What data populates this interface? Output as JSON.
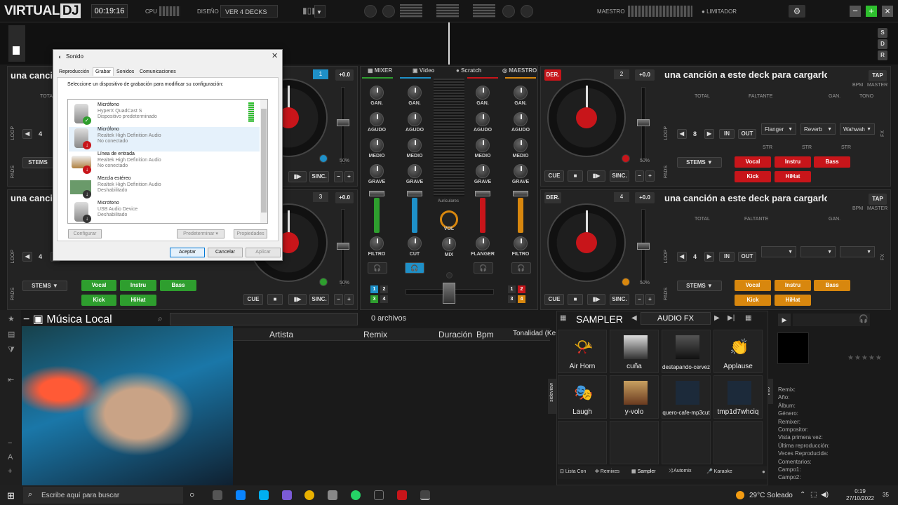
{
  "app": {
    "logo_main": "VIRTUAL",
    "logo_dj": "DJ",
    "time": "00:19:16",
    "cpu_label": "CPU",
    "design_label": "DISEÑO",
    "design_value": "VER 4 DECKS",
    "master_label": "MAESTRO",
    "limiter_label": "LIMITADOR"
  },
  "side_buttons": [
    "S",
    "D",
    "R"
  ],
  "decks": {
    "d1": {
      "title": "una canción a este deck para cargarlo",
      "title_visible": "una canci",
      "number": "1",
      "pitch": "+0.0",
      "total": "TOTAL"
    },
    "d2": {
      "title": "una canción a este deck para cargarlo",
      "number": "2",
      "pitch": "+0.0",
      "total": "TOTAL",
      "remaining": "FALTANTE",
      "gain": "GAN.",
      "tone": "TONO",
      "bpm": "BPM",
      "master": "MASTER",
      "tap": "TAP",
      "der": "DER."
    },
    "d3": {
      "title_visible": "una canci",
      "number": "3",
      "pitch": "+0.0"
    },
    "d4": {
      "title": "una canción a este deck para cargarlo",
      "number": "4",
      "pitch": "+0.0",
      "total": "TOTAL",
      "remaining": "FALTANTE",
      "gain": "GAN.",
      "bpm": "BPM",
      "master": "MASTER",
      "tap": "TAP",
      "der": "DER."
    }
  },
  "controls": {
    "loop": "LOOP",
    "pads": "PADS",
    "stems": "STEMS",
    "cue": "CUE",
    "sync": "SINC.",
    "in": "IN",
    "out": "OUT",
    "loop_d2": "8",
    "loop_d1": "4",
    "loop_d3": "4",
    "loop_d4": "4",
    "fx": "FX",
    "str": "STR",
    "fx_slots": [
      "Flanger",
      "Reverb",
      "Wahwah"
    ],
    "pad_labels": [
      "Vocal",
      "Instru",
      "Bass",
      "Kick",
      "HiHat"
    ],
    "percent": "50%"
  },
  "mixer_tabs": [
    "MIXER",
    "Video",
    "Scratch",
    "MAESTRO"
  ],
  "mixer": {
    "gain": "GAN.",
    "treble": "AGUDO",
    "mid": "MEDIO",
    "bass": "GRAVE",
    "filter": "FILTRO",
    "cut": "CUT",
    "flanger": "FLANGER",
    "headphones": "Auriculares",
    "vol": "VOL",
    "mix": "MIX",
    "decknums": [
      "1",
      "2",
      "3",
      "4"
    ]
  },
  "dialog": {
    "title": "Sonido",
    "tabs": [
      "Reproducción",
      "Grabar",
      "Sonidos",
      "Comunicaciones"
    ],
    "instruction": "Seleccione un dispositivo de grabación para modificar su configuración:",
    "devices": [
      {
        "name": "Micrófono",
        "desc": "HyperX QuadCast S",
        "status": "Dispositivo predeterminado"
      },
      {
        "name": "Micrófono",
        "desc": "Realtek High Definition Audio",
        "status": "No conectado"
      },
      {
        "name": "Línea de entrada",
        "desc": "Realtek High Definition Audio",
        "status": "No conectado"
      },
      {
        "name": "Mezcla estéreo",
        "desc": "Realtek High Definition Audio",
        "status": "Deshabilitado"
      },
      {
        "name": "Micrófono",
        "desc": "USB Audio Device",
        "status": "Deshabilitado"
      }
    ],
    "configure": "Configurar",
    "set_default": "Predeterminar",
    "properties": "Propiedades",
    "ok": "Aceptar",
    "cancel": "Cancelar",
    "apply": "Aplicar"
  },
  "browser": {
    "folder": "Música Local",
    "file_count": "0 archivos",
    "columns": [
      "Artista",
      "Remix",
      "Duración",
      "Bpm",
      "Tonalidad (Ke"
    ],
    "sideview": "sideview",
    "info": "info"
  },
  "sampler": {
    "title": "SAMPLER",
    "bank": "AUDIO FX",
    "items": [
      "Air Horn",
      "cuña",
      "destapando-cerveza",
      "Applause",
      "Laugh",
      "y-volo",
      "quero-cafe-mp3cut",
      "tmp1d7whciq"
    ],
    "tabs": [
      "Lista Con",
      "Remixes",
      "Sampler",
      "Automix",
      "Karaoke"
    ]
  },
  "info_panel": {
    "fields": [
      "Remix:",
      "Año:",
      "Álbum:",
      "Género:",
      "Remixer:",
      "Compositor:",
      "Vista primera vez:",
      "Última reproducción:",
      "Veces Reproducida:",
      "Comentarios:",
      "Campo1:",
      "Campo2:"
    ]
  },
  "taskbar": {
    "search_placeholder": "Escribe aquí para buscar",
    "weather": "29°C  Soleado",
    "time": "0:19",
    "date": "27/10/2022",
    "notif": "35"
  },
  "colors": {
    "accent_red": "#c8151a",
    "pad_green": "#2e9e2e",
    "pad_orange": "#d8870e",
    "deck1_blue": "#1e90c8"
  }
}
